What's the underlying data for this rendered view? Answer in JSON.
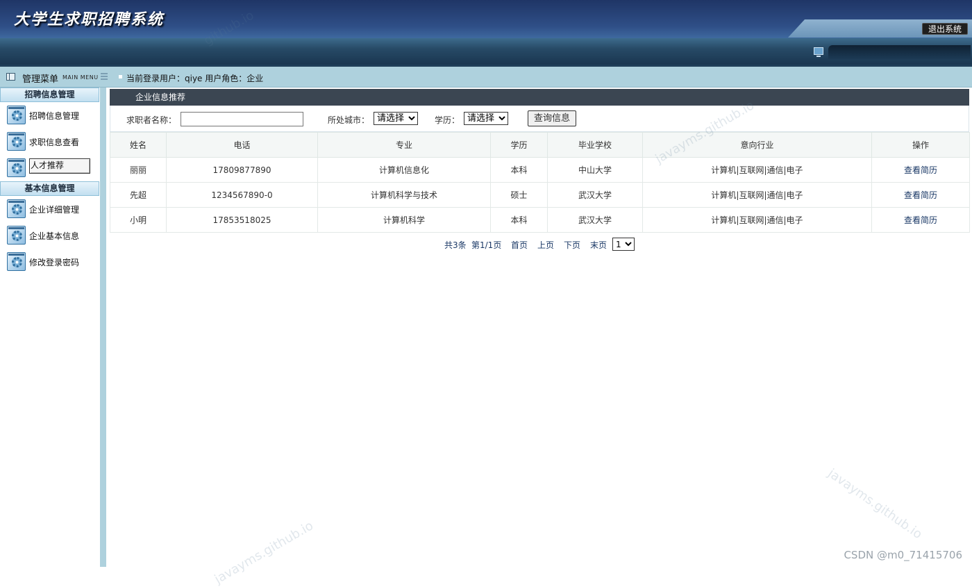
{
  "header": {
    "title": "大学生求职招聘系统",
    "logout_label": "退出系统"
  },
  "infobar": {
    "menu_label": "管理菜单",
    "menu_sub": "MAIN MENU",
    "current_user_label": "当前登录用户：qiye  用户角色：企业"
  },
  "sidebar": {
    "sections": [
      {
        "title": "招聘信息管理",
        "items": [
          {
            "label": "招聘信息管理",
            "icon": "gear-window-icon",
            "active": false
          },
          {
            "label": "求职信息查看",
            "icon": "gear-window-icon",
            "active": false
          },
          {
            "label": "人才推荐",
            "icon": "gear-window-icon",
            "active": true
          }
        ]
      },
      {
        "title": "基本信息管理",
        "items": [
          {
            "label": "企业详细管理",
            "icon": "gear-window-icon",
            "active": false
          },
          {
            "label": "企业基本信息",
            "icon": "gear-window-icon",
            "active": false
          },
          {
            "label": "修改登录密码",
            "icon": "gear-window-icon",
            "active": false
          }
        ]
      }
    ]
  },
  "main": {
    "panel_title": "企业信息推荐",
    "search": {
      "name_label": "求职者名称：",
      "name_value": "",
      "city_label": "所处城市：",
      "city_selected": "请选择",
      "edu_label": "学历：",
      "edu_selected": "请选择",
      "button_label": "查询信息"
    },
    "table": {
      "columns": [
        "姓名",
        "电话",
        "专业",
        "学历",
        "毕业学校",
        "意向行业",
        "操作"
      ],
      "rows": [
        {
          "name": "丽丽",
          "phone": "17809877890",
          "major": "计算机信息化",
          "edu": "本科",
          "school": "中山大学",
          "industry": "计算机|互联网|通信|电子",
          "action": "查看简历"
        },
        {
          "name": "先超",
          "phone": "1234567890-0",
          "major": "计算机科学与技术",
          "edu": "硕士",
          "school": "武汉大学",
          "industry": "计算机|互联网|通信|电子",
          "action": "查看简历"
        },
        {
          "name": "小明",
          "phone": "17853518025",
          "major": "计算机科学",
          "edu": "本科",
          "school": "武汉大学",
          "industry": "计算机|互联网|通信|电子",
          "action": "查看简历"
        }
      ]
    },
    "pager": {
      "total": "共3条",
      "page_info": "第1/1页",
      "first": "首页",
      "prev": "上页",
      "next": "下页",
      "last": "末页",
      "page_selected": "1"
    }
  },
  "watermarks": [
    "javayms.github.io",
    "javayms.github.io",
    "javayms.github.io",
    "github.io"
  ],
  "footer_credit": "CSDN @m0_71415706"
}
